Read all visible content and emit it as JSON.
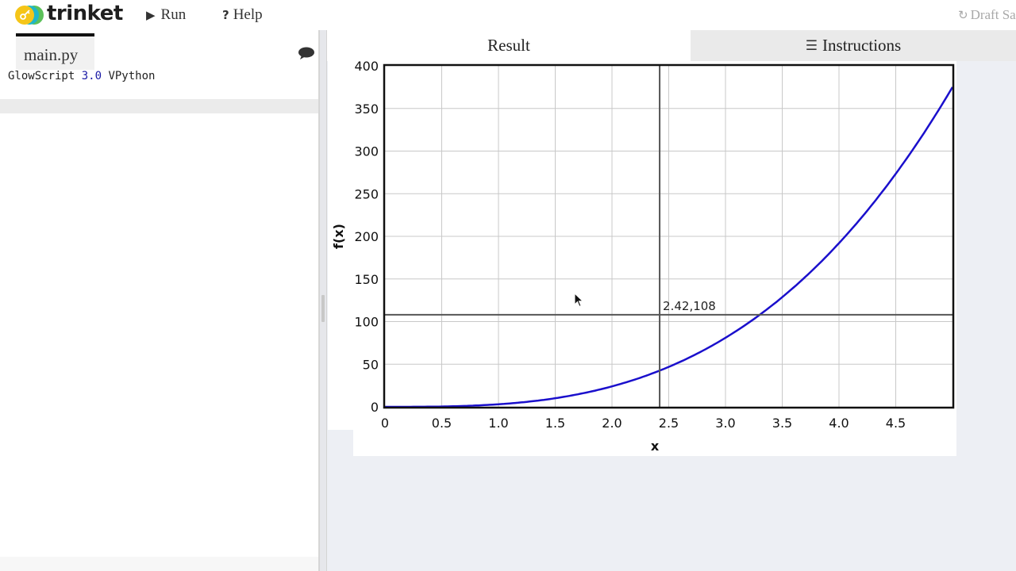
{
  "topbar": {
    "brand": "trinket",
    "run_label": "Run",
    "help_label": "Help",
    "draft_status": "Draft Sa"
  },
  "editor": {
    "file_tab": "main.py",
    "code_line_1": {
      "prefix": "GlowScript ",
      "version": "3.0",
      "suffix": " VPython"
    }
  },
  "output": {
    "tabs": {
      "result": "Result",
      "instructions": "Instructions"
    }
  },
  "colors": {
    "curve": "#1a0fcc",
    "crosshair": "#555555",
    "grid": "#c8c8c8",
    "plot_border": "#111111",
    "logo_yellow": "#f5c518",
    "logo_teal": "#1fb6c9",
    "logo_green": "#5cc15a"
  },
  "icons": {
    "logo": "trinket-logo-icon",
    "run": "play-icon",
    "help": "question-icon",
    "draft": "refresh-icon",
    "comment": "comment-icon",
    "instructions": "list-icon",
    "cursor": "mouse-cursor-icon"
  },
  "chart_data": {
    "type": "line",
    "function": "3*x^3",
    "title": "",
    "xlabel": "x",
    "ylabel": "f(x)",
    "xlim": [
      0,
      5
    ],
    "ylim": [
      0,
      400
    ],
    "x_ticks": [
      "0",
      "0.5",
      "1.0",
      "1.5",
      "2.0",
      "2.5",
      "3.0",
      "3.5",
      "4.0",
      "4.5"
    ],
    "y_ticks": [
      "0",
      "50",
      "100",
      "150",
      "200",
      "250",
      "300",
      "350",
      "400"
    ],
    "grid": true,
    "series": [
      {
        "x": [
          0,
          0.5,
          1.0,
          1.5,
          2.0,
          2.5,
          3.0,
          3.5,
          4.0,
          4.5,
          5.0
        ],
        "y": [
          0,
          0.375,
          3,
          10.1,
          24,
          46.9,
          81,
          128.6,
          192,
          273.4,
          364
        ]
      }
    ],
    "crosshair": {
      "x": 2.42,
      "y": 108,
      "label": "2.42,108"
    }
  }
}
